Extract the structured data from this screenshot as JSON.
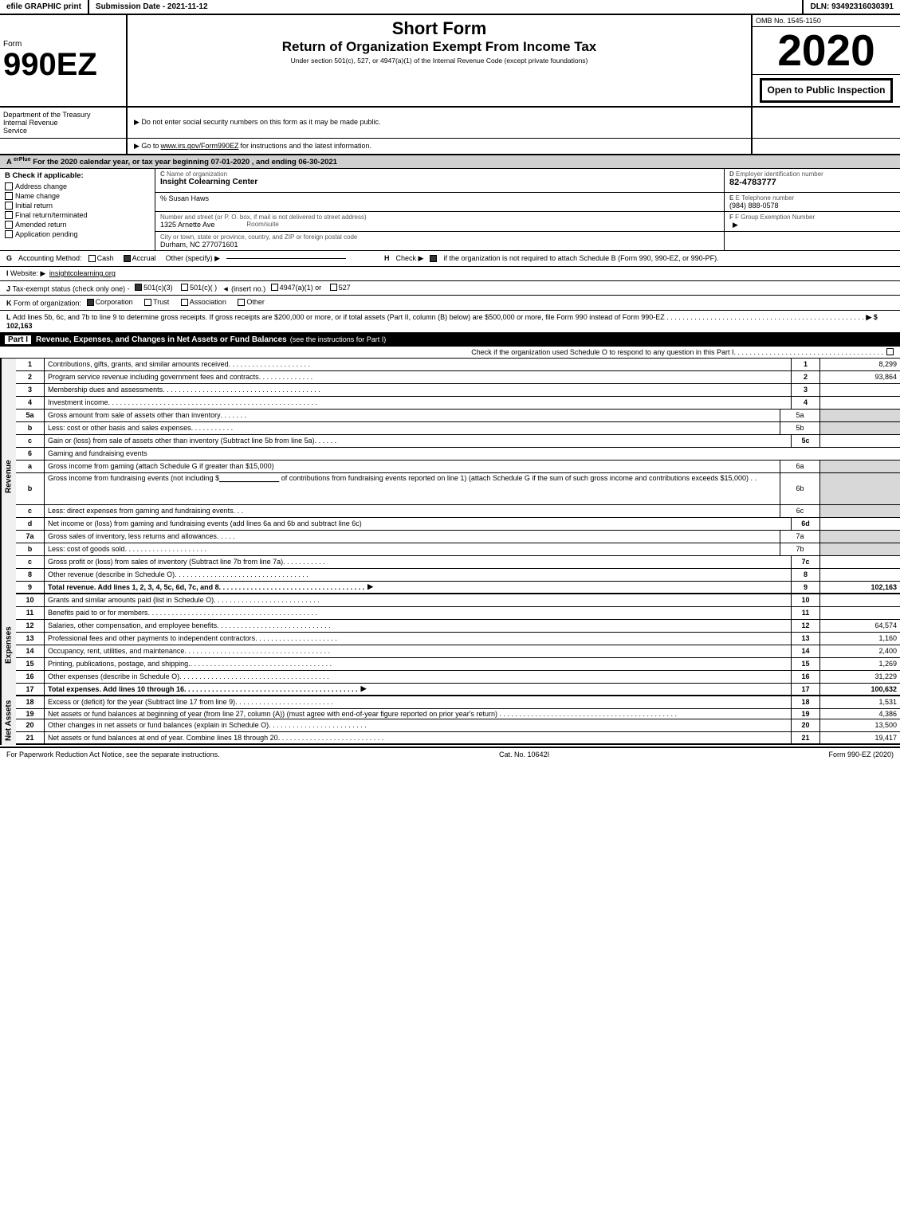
{
  "topBar": {
    "left": "efile GRAPHIC print",
    "mid": "Submission Date - 2021-11-12",
    "right": "DLN: 93492316030391"
  },
  "header": {
    "formLabel": "Form",
    "formNumber": "990EZ",
    "shortForm": "Short Form",
    "returnTitle": "Return of Organization Exempt From Income Tax",
    "underSection": "Under section 501(c), 527, or 4947(a)(1) of the Internal Revenue Code (except private foundations)",
    "notice1": "▶ Do not enter social security numbers on this form as it may be made public.",
    "notice2": "▶ Go to www.irs.gov/Form990EZ for instructions and the latest information.",
    "notice2Link": "www.irs.gov/Form990EZ",
    "omb": "OMB No. 1545-1150",
    "year": "2020",
    "openToPublic": "Open to Public Inspection"
  },
  "sectionA": {
    "label": "A",
    "text": "For the 2020 calendar year, or tax year beginning 07-01-2020 , and ending 06-30-2021"
  },
  "sectionB": {
    "label": "B",
    "checkLabel": "Check if applicable:",
    "checks": [
      {
        "label": "Address change",
        "checked": false
      },
      {
        "label": "Name change",
        "checked": false
      },
      {
        "label": "Initial return",
        "checked": false
      },
      {
        "label": "Final return/terminated",
        "checked": false
      },
      {
        "label": "Amended return",
        "checked": false
      },
      {
        "label": "Application pending",
        "checked": false
      }
    ]
  },
  "sectionC": {
    "label": "C",
    "nameLabel": "Name of organization",
    "name": "Insight Colearning Center",
    "careOf": "% Susan Haws",
    "streetLabel": "Number and street (or P. O. box, if mail is not delivered to street address)",
    "street": "1325 Arnette Ave",
    "roomSuiteLabel": "Room/suite",
    "roomSuite": "",
    "cityLabel": "City or town, state or province, country, and ZIP or foreign postal code",
    "city": "Durham, NC  277071601"
  },
  "sectionD": {
    "label": "D",
    "employerIdLabel": "Employer identification number",
    "ein": "82-4783777",
    "phoneLabel": "E Telephone number",
    "phone": "(984) 888-0578",
    "groupExLabel": "F Group Exemption Number",
    "groupEx": ""
  },
  "sectionG": {
    "label": "G",
    "accountingLabel": "Accounting Method:",
    "cashLabel": "Cash",
    "accrualLabel": "Accrual",
    "accrualChecked": true,
    "otherLabel": "Other (specify) ▶",
    "otherValue": ""
  },
  "sectionH": {
    "label": "H",
    "text": "Check ▶",
    "checkChecked": true,
    "description": "if the organization is not required to attach Schedule B (Form 990, 990-EZ, or 990-PF)."
  },
  "sectionI": {
    "label": "I",
    "websiteLabel": "Website: ▶",
    "website": "insightcolearning.org"
  },
  "sectionJ": {
    "label": "J",
    "taxStatusLabel": "Tax-exempt status",
    "checkOnly": "(check only one) -",
    "options": [
      {
        "label": "501(c)(3)",
        "checked": true
      },
      {
        "label": "501(c)(  )",
        "checked": false
      },
      {
        "label": "(insert no.)",
        "checked": false
      },
      {
        "label": "4947(a)(1) or",
        "checked": false
      },
      {
        "label": "527",
        "checked": false
      }
    ]
  },
  "sectionK": {
    "label": "K",
    "orgLabel": "Form of organization:",
    "options": [
      {
        "label": "Corporation",
        "checked": true
      },
      {
        "label": "Trust",
        "checked": false
      },
      {
        "label": "Association",
        "checked": false
      },
      {
        "label": "Other",
        "checked": false
      }
    ]
  },
  "sectionL": {
    "label": "L",
    "text": "Add lines 5b, 6c, and 7b to line 9 to determine gross receipts. If gross receipts are $200,000 or more, or if total assets (Part II, column (B) below) are $500,000 or more, file Form 990 instead of Form 990-EZ",
    "dots": ". . . . . . . . . . . . . . . . . . . . . . . . . . . . . . . . . . . . . . . . . . . . . . . . . .",
    "arrow": "▶",
    "amount": "$ 102,163"
  },
  "partI": {
    "label": "Part I",
    "title": "Revenue, Expenses, and Changes in Net Assets or Fund Balances",
    "titleSub": "(see the instructions for Part I)",
    "checkText": "Check if the organization used Schedule O to respond to any question in this Part I",
    "dots": ". . . . . . . . . . . . . . . . . . . . . . . . . . . . . . . . . . . . . .",
    "lines": [
      {
        "num": "1",
        "desc": "Contributions, gifts, grants, and similar amounts received",
        "dots": ". . . . . . . . . . . . . . . . . . . . .",
        "lineRef": "1",
        "amount": "8,299"
      },
      {
        "num": "2",
        "desc": "Program service revenue including government fees and contracts",
        "dots": ". . . . . . . . . . . . . . .",
        "lineRef": "2",
        "amount": "93,864"
      },
      {
        "num": "3",
        "desc": "Membership dues and assessments",
        "dots": ". . . . . . . . . . . . . . . . . . . . . . . . . . . . . . . . . . . . . . . . .",
        "lineRef": "3",
        "amount": ""
      },
      {
        "num": "4",
        "desc": "Investment income",
        "dots": ". . . . . . . . . . . . . . . . . . . . . . . . . . . . . . . . . . . . . . . . . . . . . . . . . . . . . .",
        "lineRef": "4",
        "amount": ""
      }
    ],
    "line5a": {
      "num": "5a",
      "desc": "Gross amount from sale of assets other than inventory",
      "dots": ". . . . . . .",
      "ref": "5a",
      "amount": ""
    },
    "line5b": {
      "num": "b",
      "desc": "Less: cost or other basis and sales expenses",
      "dots": ". . . . . . . . . . .",
      "ref": "5b",
      "amount": ""
    },
    "line5c": {
      "num": "c",
      "desc": "Gain or (loss) from sale of assets other than inventory (Subtract line 5b from line 5a)",
      "dots": ". . . . . .",
      "ref": "5c",
      "amount": ""
    },
    "line6": {
      "num": "6",
      "desc": "Gaming and fundraising events"
    },
    "line6a": {
      "num": "a",
      "desc": "Gross income from gaming (attach Schedule G if greater than $15,000)",
      "ref": "6a",
      "amount": ""
    },
    "line6b": {
      "num": "b",
      "desc": "Gross income from fundraising events (not including $",
      "blank": "_______________",
      "ofContrib": "of contributions from fundraising events reported on line 1) (attach Schedule G if the sum of such gross income and contributions exceeds $15,000)",
      "dots": ". .",
      "ref": "6b",
      "amount": ""
    },
    "line6c": {
      "num": "c",
      "desc": "Less: direct expenses from gaming and fundraising events",
      "dots": ". . .",
      "ref": "6c",
      "amount": ""
    },
    "line6d": {
      "num": "d",
      "desc": "Net income or (loss) from gaming and fundraising events (add lines 6a and 6b and subtract line 6c)",
      "ref": "6d",
      "amount": ""
    },
    "line7a": {
      "num": "7a",
      "desc": "Gross sales of inventory, less returns and allowances",
      "dots": ". . . . .",
      "ref": "7a",
      "amount": ""
    },
    "line7b": {
      "num": "b",
      "desc": "Less: cost of goods sold",
      "dots": ". . . . . . . . . . . . . . . . . . . . .",
      "ref": "7b",
      "amount": ""
    },
    "line7c": {
      "num": "c",
      "desc": "Gross profit or (loss) from sales of inventory (Subtract line 7b from line 7a)",
      "dots": ". . . . . . . . . . .",
      "ref": "7c",
      "amount": ""
    },
    "line8": {
      "num": "8",
      "desc": "Other revenue (describe in Schedule O)",
      "dots": ". . . . . . . . . . . . . . . . . . . . . . . . . . . . . . . . . .",
      "lineRef": "8",
      "amount": ""
    },
    "line9": {
      "num": "9",
      "desc": "Total revenue. Add lines 1, 2, 3, 4, 5c, 6d, 7c, and 8",
      "dots": ". . . . . . . . . . . . . . . . . . . . . . . . . . . . . . . . . . . . .",
      "arrow": "▶",
      "lineRef": "9",
      "amount": "102,163"
    }
  },
  "expenses": {
    "lines": [
      {
        "num": "10",
        "desc": "Grants and similar amounts paid (list in Schedule O)",
        "dots": ". . . . . . . . . . . . . . . . . . . . . . . . . . .",
        "lineRef": "10",
        "amount": ""
      },
      {
        "num": "11",
        "desc": "Benefits paid to or for members",
        "dots": ". . . . . . . . . . . . . . . . . . . . . . . . . . . . . . . . . . . . . . . . . . .",
        "lineRef": "11",
        "amount": ""
      },
      {
        "num": "12",
        "desc": "Salaries, other compensation, and employee benefits",
        "dots": ". . . . . . . . . . . . . . . . . . . . . . . . . . . . . .",
        "lineRef": "12",
        "amount": "64,574"
      },
      {
        "num": "13",
        "desc": "Professional fees and other payments to independent contractors",
        "dots": ". . . . . . . . . . . . . . . . . . . . .",
        "lineRef": "13",
        "amount": "1,160"
      },
      {
        "num": "14",
        "desc": "Occupancy, rent, utilities, and maintenance",
        "dots": ". . . . . . . . . . . . . . . . . . . . . . . . . . . . . . . . . . . . . .",
        "lineRef": "14",
        "amount": "2,400"
      },
      {
        "num": "15",
        "desc": "Printing, publications, postage, and shipping.",
        "dots": ". . . . . . . . . . . . . . . . . . . . . . . . . . . . . . . . . . . .",
        "lineRef": "15",
        "amount": "1,269"
      },
      {
        "num": "16",
        "desc": "Other expenses (describe in Schedule O)",
        "dots": ". . . . . . . . . . . . . . . . . . . . . . . . . . . . . . . . . . . . . .",
        "lineRef": "16",
        "amount": "31,229"
      },
      {
        "num": "17",
        "desc": "Total expenses. Add lines 10 through 16",
        "dots": ". . . . . . . . . . . . . . . . . . . . . . . . . . . . . . . . . . . . . . . . . . . .",
        "arrow": "▶",
        "lineRef": "17",
        "amount": "100,632",
        "bold": true
      }
    ]
  },
  "netAssets": {
    "lines": [
      {
        "num": "18",
        "desc": "Excess or (deficit) for the year (Subtract line 17 from line 9)",
        "dots": ". . . . . . . . . . . . . . . . . . . . . . . . .",
        "lineRef": "18",
        "amount": "1,531"
      },
      {
        "num": "19",
        "desc": "Net assets or fund balances at beginning of year (from line 27, column (A)) (must agree with end-of-year figure reported on prior year's return)",
        "dots": ". . . . . . . . . . . . . . . . . . . . . . . . . . . . . . . . . . . . . . . . . .",
        "lineRef": "19",
        "amount": "4,386"
      },
      {
        "num": "20",
        "desc": "Other changes in net assets or fund balances (explain in Schedule O)",
        "dots": ". . . . . . . . . . . . . . . . . . . . . . . . .",
        "lineRef": "20",
        "amount": "13,500"
      },
      {
        "num": "21",
        "desc": "Net assets or fund balances at end of year. Combine lines 18 through 20",
        "dots": ". . . . . . . . . . . . . . . . . . . . . . . . . . . .",
        "lineRef": "21",
        "amount": "19,417"
      }
    ]
  },
  "footer": {
    "paperworkText": "For Paperwork Reduction Act Notice, see the separate instructions.",
    "catNo": "Cat. No. 10642I",
    "formLabel": "Form 990-EZ (2020)"
  }
}
